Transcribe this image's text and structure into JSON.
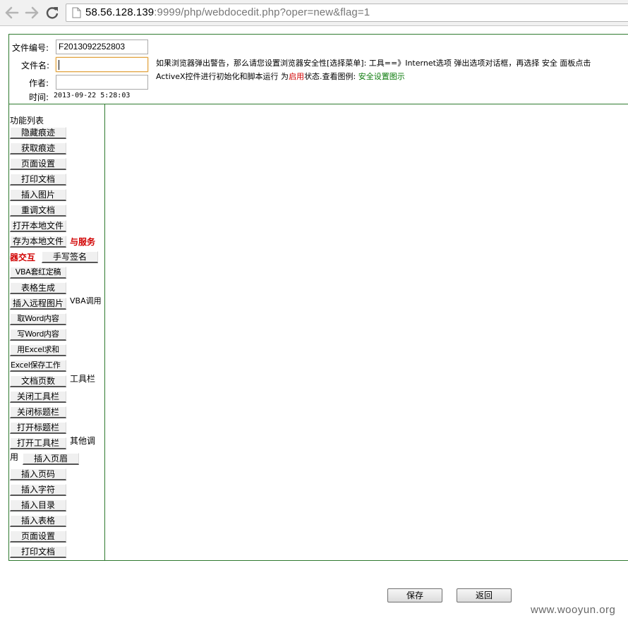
{
  "browser": {
    "url_host": "58.56.128.139",
    "url_rest": ":9999/php/webdocedit.php?oper=new&flag=1"
  },
  "form": {
    "doc_no_label": "文件编号:",
    "doc_no_value": "F2013092252803",
    "doc_name_label": "文件名:",
    "doc_name_value": "",
    "author_label": "作者:",
    "author_value": "",
    "time_label": "时间:",
    "time_value": "2013-09-22 5:28:03"
  },
  "notice": {
    "line1": "如果浏览器弹出警告，那么请您设置浏览器安全性[选择菜单]: 工具==》Internet选项 弹出选项对话框，再选择 安全 面板点击",
    "line2_a": "ActiveX控件进行初始化和脚本运行 为",
    "line2_enabled": "启用",
    "line2_b": "状态.查看图例: ",
    "line2_link": "安全设置图示"
  },
  "sidebar": {
    "title": "功能列表",
    "buttons": [
      "隐藏痕迹",
      "获取痕迹",
      "页面设置",
      "打印文档",
      "插入图片",
      "重调文档",
      "打开本地文件",
      "存为本地文件",
      "手写签名",
      "VBA套红定稿",
      "表格生成",
      "插入远程图片",
      "取Word内容",
      "写Word内容",
      "用Excel求和",
      "Excel保存工作",
      "文档页数",
      "关闭工具栏",
      "关闭标题栏",
      "打开标题栏",
      "打开工具栏",
      "插入页眉",
      "插入页码",
      "插入字符",
      "插入目录",
      "插入表格",
      "页面设置",
      "打印文档"
    ],
    "groups": {
      "server_a": "与服务",
      "server_b": "器交互",
      "vba": "VBA调用",
      "toolbar": "工具栏",
      "other_a": "其他调",
      "other_b": "用"
    }
  },
  "footer": {
    "save_label": "保存",
    "back_label": "返回"
  },
  "watermark": "www.wooyun.org"
}
